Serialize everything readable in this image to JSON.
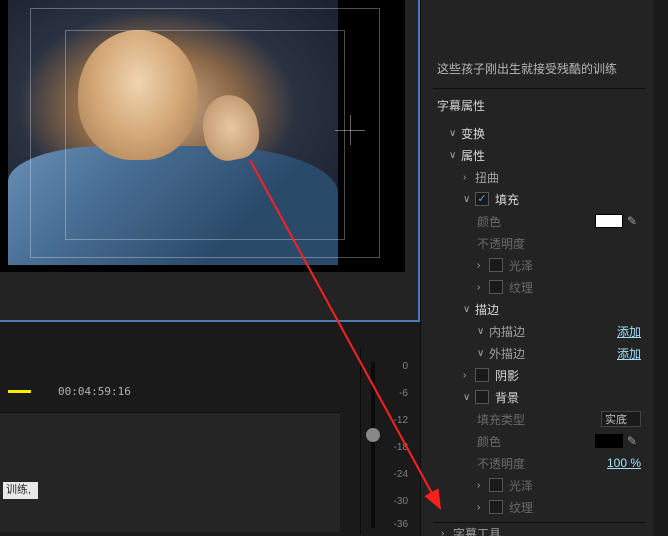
{
  "preview": {
    "caption_clip_text": "训练,"
  },
  "timecode": "00:04:59:16",
  "audio_meter_ticks": [
    "0",
    "-6",
    "-12",
    "-18",
    "-24",
    "-30",
    "-36"
  ],
  "caption_text": "这些孩子刚出生就接受残酷的训练",
  "panel": {
    "section_title": "字幕属性",
    "transform_label": "变换",
    "attributes_label": "属性",
    "distort_label": "扭曲",
    "fill_label": "填充",
    "color_label": "颜色",
    "opacity_label": "不透明度",
    "gloss_label": "光泽",
    "texture_label": "纹理",
    "stroke_label": "描边",
    "inner_stroke_label": "内描边",
    "outer_stroke_label": "外描边",
    "add_link": "添加",
    "shadow_label": "阴影",
    "background_label": "背景",
    "fill_type_label": "填充类型",
    "fill_type_value": "实底",
    "opacity_value": "100 %",
    "tools_title": "字幕工具"
  }
}
